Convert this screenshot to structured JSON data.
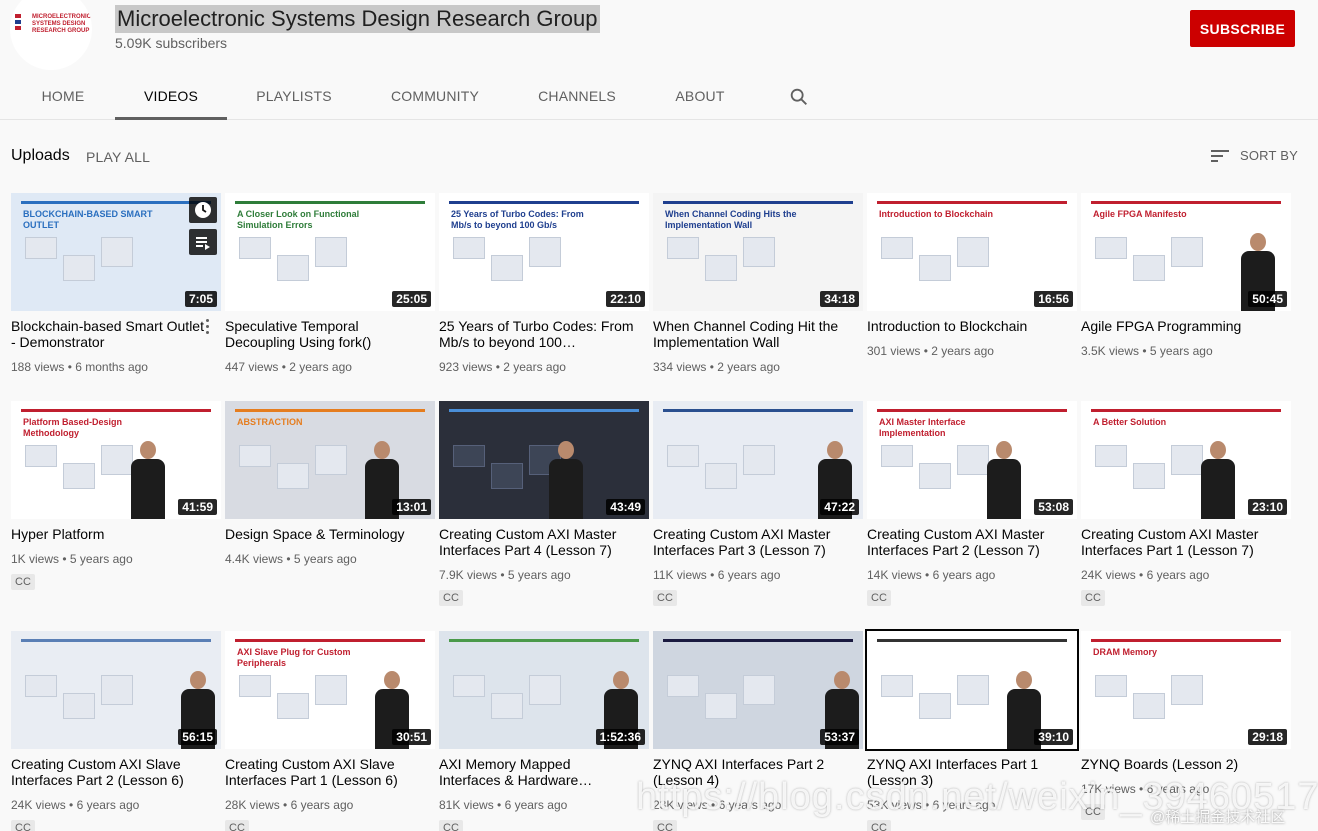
{
  "channel": {
    "logo_text": "MICROELECTRONIC SYSTEMS DESIGN RESEARCH GROUP",
    "name": "Microelectronic Systems Design Research Group",
    "subscribers": "5.09K subscribers",
    "subscribe_label": "SUBSCRIBE"
  },
  "tabs": [
    {
      "label": "HOME",
      "active": false
    },
    {
      "label": "VIDEOS",
      "active": true
    },
    {
      "label": "PLAYLISTS",
      "active": false
    },
    {
      "label": "COMMUNITY",
      "active": false
    },
    {
      "label": "CHANNELS",
      "active": false
    },
    {
      "label": "ABOUT",
      "active": false
    }
  ],
  "search_icon": "search-icon",
  "section": {
    "title": "Uploads",
    "play_all": "PLAY ALL",
    "sort_label": "SORT BY",
    "sort_icon": "sort-icon"
  },
  "colors": {
    "accent": "#cc0000",
    "text_primary": "#030303",
    "text_secondary": "#606060",
    "background": "#f9f9f9"
  },
  "videos": [
    {
      "title": "Blockchain-based Smart Outlet - Demonstrator",
      "views": "188 views",
      "age": "6 months ago",
      "duration": "7:05",
      "cc": false,
      "thumb_text": "BLOCKCHAIN-BASED SMART OUTLET",
      "hover": true
    },
    {
      "title": "Speculative Temporal Decoupling Using fork()",
      "views": "447 views",
      "age": "2 years ago",
      "duration": "25:05",
      "cc": false,
      "thumb_text": "A Closer Look on Functional Simulation Errors"
    },
    {
      "title": "25 Years of Turbo Codes: From Mb/s to beyond 100…",
      "views": "923 views",
      "age": "2 years ago",
      "duration": "22:10",
      "cc": false,
      "thumb_text": "25 Years of Turbo Codes: From Mb/s to beyond 100 Gb/s"
    },
    {
      "title": "When Channel Coding Hit the Implementation Wall",
      "views": "334 views",
      "age": "2 years ago",
      "duration": "34:18",
      "cc": false,
      "thumb_text": "When Channel Coding Hits the Implementation Wall"
    },
    {
      "title": "Introduction to Blockchain",
      "views": "301 views",
      "age": "2 years ago",
      "duration": "16:56",
      "cc": false,
      "thumb_text": "Introduction to Blockchain"
    },
    {
      "title": "Agile FPGA Programming",
      "views": "3.5K views",
      "age": "5 years ago",
      "duration": "50:45",
      "cc": false,
      "thumb_text": "Agile FPGA Manifesto"
    },
    {
      "title": "Hyper Platform",
      "views": "1K views",
      "age": "5 years ago",
      "duration": "41:59",
      "cc": true,
      "thumb_text": "Platform Based-Design Methodology"
    },
    {
      "title": "Design Space & Terminology",
      "views": "4.4K views",
      "age": "5 years ago",
      "duration": "13:01",
      "cc": false,
      "thumb_text": "ABSTRACTION"
    },
    {
      "title": "Creating Custom AXI Master Interfaces Part 4 (Lesson 7)",
      "views": "7.9K views",
      "age": "5 years ago",
      "duration": "43:49",
      "cc": true,
      "thumb_text": ""
    },
    {
      "title": "Creating Custom AXI Master Interfaces Part 3 (Lesson 7)",
      "views": "11K views",
      "age": "6 years ago",
      "duration": "47:22",
      "cc": true,
      "thumb_text": ""
    },
    {
      "title": "Creating Custom AXI Master Interfaces Part 2 (Lesson 7)",
      "views": "14K views",
      "age": "6 years ago",
      "duration": "53:08",
      "cc": true,
      "thumb_text": "AXI Master Interface Implementation"
    },
    {
      "title": "Creating Custom AXI Master Interfaces Part 1 (Lesson 7)",
      "views": "24K views",
      "age": "6 years ago",
      "duration": "23:10",
      "cc": true,
      "thumb_text": "A Better Solution"
    },
    {
      "title": "Creating Custom AXI Slave Interfaces Part 2 (Lesson 6)",
      "views": "24K views",
      "age": "6 years ago",
      "duration": "56:15",
      "cc": true,
      "thumb_text": ""
    },
    {
      "title": "Creating Custom AXI Slave Interfaces Part 1 (Lesson 6)",
      "views": "28K views",
      "age": "6 years ago",
      "duration": "30:51",
      "cc": true,
      "thumb_text": "AXI Slave Plug for Custom Peripherals"
    },
    {
      "title": "AXI Memory Mapped Interfaces & Hardware…",
      "views": "81K views",
      "age": "6 years ago",
      "duration": "1:52:36",
      "cc": true,
      "thumb_text": ""
    },
    {
      "title": "ZYNQ AXI Interfaces Part 2 (Lesson 4)",
      "views": "23K views",
      "age": "6 years ago",
      "duration": "53:37",
      "cc": true,
      "thumb_text": ""
    },
    {
      "title": "ZYNQ AXI Interfaces Part 1 (Lesson 3)",
      "views": "53K views",
      "age": "6 years ago",
      "duration": "39:10",
      "cc": true,
      "thumb_text": ""
    },
    {
      "title": "ZYNQ Boards (Lesson 2)",
      "views": "17K views",
      "age": "6 years ago",
      "duration": "29:18",
      "cc": true,
      "thumb_text": "DRAM Memory"
    }
  ],
  "cc_label": "CC",
  "watermark": {
    "url": "https://blog.csdn.net/weixin_39460517",
    "site": "@稀土掘金技术社区"
  }
}
